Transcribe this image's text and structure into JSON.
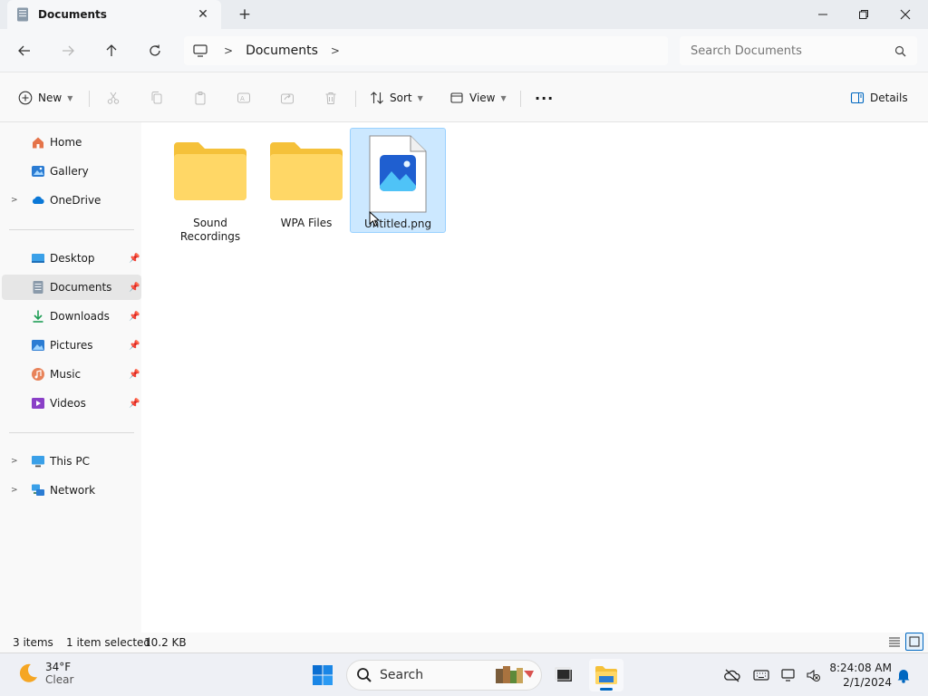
{
  "window": {
    "tab_title": "Documents",
    "new_tab": "+",
    "tab_close": "✕",
    "minimize": "—",
    "maximize": "❐",
    "close": "✕"
  },
  "address": {
    "crumbs": [
      "Documents"
    ],
    "search_placeholder": "Search Documents"
  },
  "toolbar": {
    "new_label": "New",
    "sort_label": "Sort",
    "view_label": "View",
    "more_label": "···",
    "details_label": "Details"
  },
  "sidebar": {
    "items": [
      {
        "label": "Home",
        "icon": "home-icon"
      },
      {
        "label": "Gallery",
        "icon": "gallery-icon"
      },
      {
        "label": "OneDrive",
        "icon": "cloud-icon"
      },
      {
        "label": "Desktop",
        "icon": "desktop-icon"
      },
      {
        "label": "Documents",
        "icon": "documents-icon"
      },
      {
        "label": "Downloads",
        "icon": "downloads-icon"
      },
      {
        "label": "Pictures",
        "icon": "pictures-icon"
      },
      {
        "label": "Music",
        "icon": "music-icon"
      },
      {
        "label": "Videos",
        "icon": "videos-icon"
      },
      {
        "label": "This PC",
        "icon": "computer-icon"
      },
      {
        "label": "Network",
        "icon": "network-icon"
      }
    ]
  },
  "files": [
    {
      "name_line1": "Sound",
      "name_line2": "Recordings",
      "type": "folder"
    },
    {
      "name_line1": "WPA Files",
      "name_line2": "",
      "type": "folder"
    },
    {
      "name_line1": "Untitled.png",
      "name_line2": "",
      "type": "image",
      "selected": true
    }
  ],
  "status": {
    "count": "3 items",
    "selection": "1 item selected",
    "size": "10.2 KB"
  },
  "taskbar": {
    "temp": "34°F",
    "condition": "Clear",
    "search_label": "Search",
    "time": "8:24:08 AM",
    "date": "2/1/2024"
  },
  "colors": {
    "selection_bg": "#cce8ff",
    "selection_border": "#99d1ff",
    "folder_yellow": "#ffd766",
    "accent": "#0067c0"
  }
}
